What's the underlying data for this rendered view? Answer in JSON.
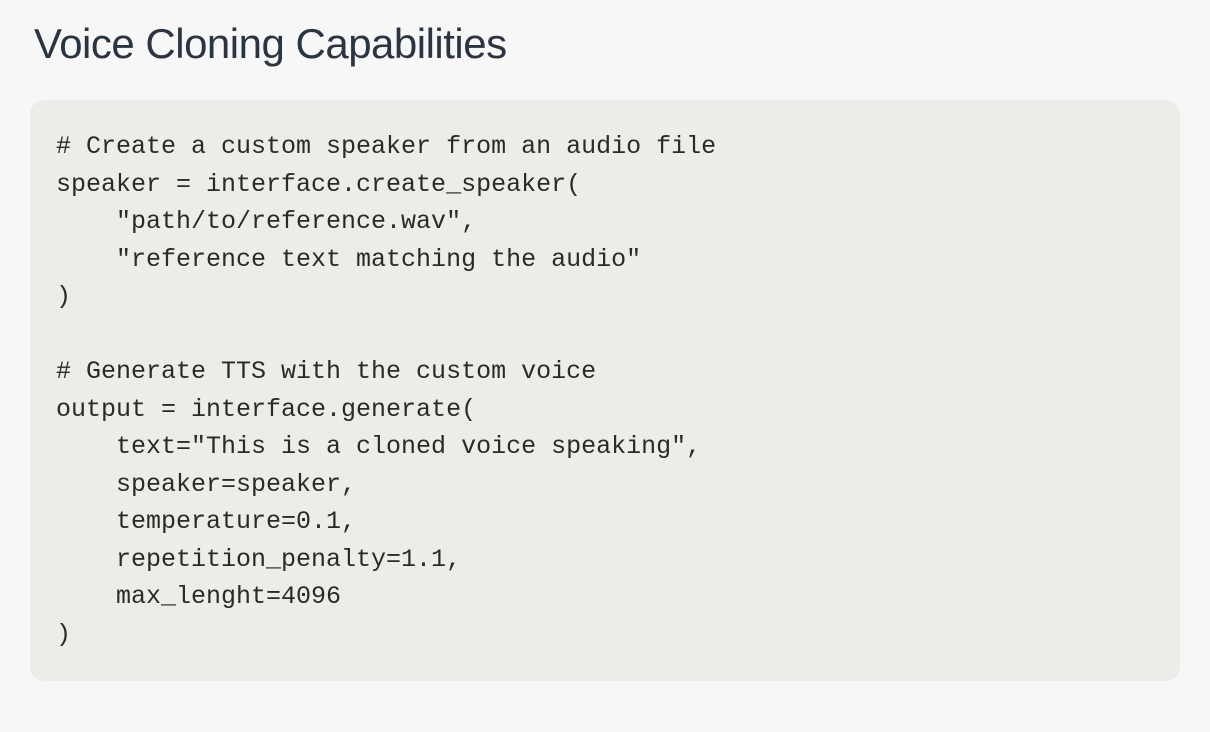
{
  "heading": "Voice Cloning Capabilities",
  "code": "# Create a custom speaker from an audio file\nspeaker = interface.create_speaker(\n    \"path/to/reference.wav\",\n    \"reference text matching the audio\"\n)\n\n# Generate TTS with the custom voice\noutput = interface.generate(\n    text=\"This is a cloned voice speaking\",\n    speaker=speaker,\n    temperature=0.1,\n    repetition_penalty=1.1,\n    max_lenght=4096\n)"
}
